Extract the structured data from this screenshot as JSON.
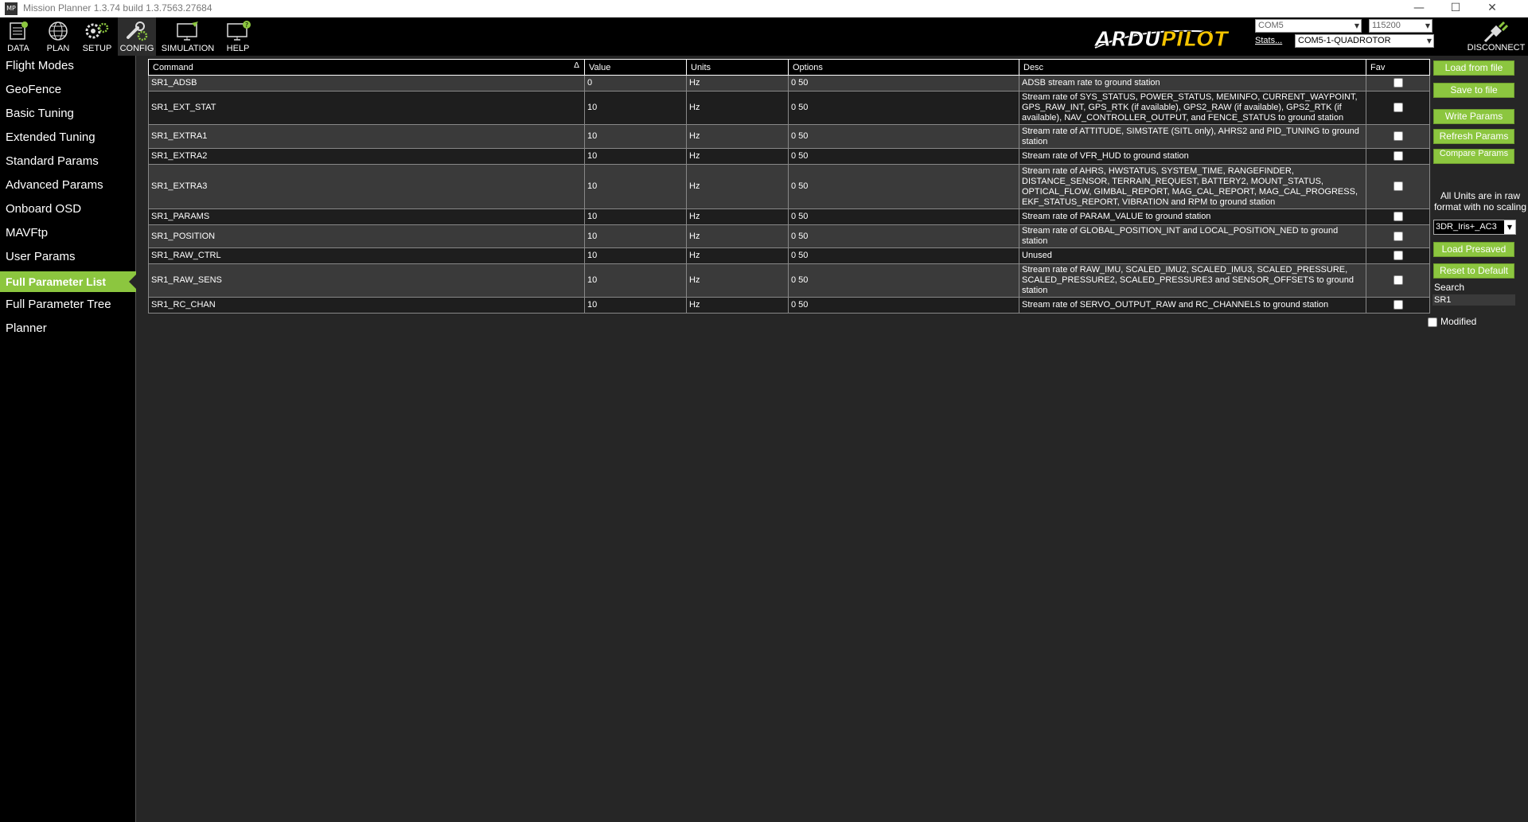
{
  "window": {
    "title": "Mission Planner 1.3.74 build 1.3.7563.27684",
    "app_icon": "MP"
  },
  "toolbar": {
    "buttons": [
      {
        "label": "DATA",
        "icon": "data-icon"
      },
      {
        "label": "PLAN",
        "icon": "globe-icon"
      },
      {
        "label": "SETUP",
        "icon": "gears-icon"
      },
      {
        "label": "CONFIG",
        "icon": "wrench-icon"
      },
      {
        "label": "SIMULATION",
        "icon": "monitor-plane-icon"
      },
      {
        "label": "HELP",
        "icon": "monitor-help-icon"
      }
    ],
    "active": "CONFIG",
    "logo": {
      "part1": "ARDU",
      "part2": "PILOT"
    },
    "port": "COM5",
    "baud": "115200",
    "stats_link": "Stats...",
    "connection": "COM5-1-QUADROTOR",
    "disconnect_label": "DISCONNECT"
  },
  "sidebar": {
    "items": [
      {
        "label": "Flight Modes"
      },
      {
        "label": "GeoFence"
      },
      {
        "label": "Basic Tuning"
      },
      {
        "label": "Extended Tuning"
      },
      {
        "label": "Standard Params"
      },
      {
        "label": "Advanced Params"
      },
      {
        "label": "Onboard OSD"
      },
      {
        "label": "MAVFtp"
      },
      {
        "label": "User Params"
      },
      {
        "label": "Full Parameter List"
      },
      {
        "label": "Full Parameter Tree"
      },
      {
        "label": "Planner"
      }
    ],
    "active": "Full Parameter List"
  },
  "table": {
    "headers": {
      "command": "Command",
      "value": "Value",
      "units": "Units",
      "options": "Options",
      "desc": "Desc",
      "fav": "Fav"
    },
    "sort_indicator": "Δ",
    "rows": [
      {
        "command": "SR1_ADSB",
        "value": "0",
        "units": "Hz",
        "options": "0 50",
        "desc": "ADSB stream rate to ground station"
      },
      {
        "command": "SR1_EXT_STAT",
        "value": "10",
        "units": "Hz",
        "options": "0 50",
        "desc": "Stream rate of SYS_STATUS, POWER_STATUS, MEMINFO, CURRENT_WAYPOINT, GPS_RAW_INT, GPS_RTK (if available), GPS2_RAW (if available), GPS2_RTK (if available), NAV_CONTROLLER_OUTPUT, and FENCE_STATUS to ground station"
      },
      {
        "command": "SR1_EXTRA1",
        "value": "10",
        "units": "Hz",
        "options": "0 50",
        "desc": "Stream rate of ATTITUDE, SIMSTATE (SITL only), AHRS2 and PID_TUNING to ground station"
      },
      {
        "command": "SR1_EXTRA2",
        "value": "10",
        "units": "Hz",
        "options": "0 50",
        "desc": "Stream rate of VFR_HUD to ground station"
      },
      {
        "command": "SR1_EXTRA3",
        "value": "10",
        "units": "Hz",
        "options": "0 50",
        "desc": "Stream rate of AHRS, HWSTATUS, SYSTEM_TIME, RANGEFINDER, DISTANCE_SENSOR, TERRAIN_REQUEST, BATTERY2, MOUNT_STATUS, OPTICAL_FLOW, GIMBAL_REPORT, MAG_CAL_REPORT, MAG_CAL_PROGRESS, EKF_STATUS_REPORT, VIBRATION and RPM to ground station"
      },
      {
        "command": "SR1_PARAMS",
        "value": "10",
        "units": "Hz",
        "options": "0 50",
        "desc": "Stream rate of PARAM_VALUE to ground station"
      },
      {
        "command": "SR1_POSITION",
        "value": "10",
        "units": "Hz",
        "options": "0 50",
        "desc": "Stream rate of GLOBAL_POSITION_INT and LOCAL_POSITION_NED to ground station"
      },
      {
        "command": "SR1_RAW_CTRL",
        "value": "10",
        "units": "Hz",
        "options": "0 50",
        "desc": "Unused"
      },
      {
        "command": "SR1_RAW_SENS",
        "value": "10",
        "units": "Hz",
        "options": "0 50",
        "desc": "Stream rate of RAW_IMU, SCALED_IMU2, SCALED_IMU3, SCALED_PRESSURE, SCALED_PRESSURE2, SCALED_PRESSURE3 and SENSOR_OFFSETS to ground station"
      },
      {
        "command": "SR1_RC_CHAN",
        "value": "10",
        "units": "Hz",
        "options": "0 50",
        "desc": "Stream rate of SERVO_OUTPUT_RAW and RC_CHANNELS to ground station"
      }
    ]
  },
  "right_panel": {
    "load_from_file": "Load from file",
    "save_to_file": "Save to file",
    "write_params": "Write Params",
    "refresh_params": "Refresh Params",
    "compare_params": "Compare Params",
    "note_line1": "All Units are in raw",
    "note_line2": "format with no scaling",
    "preset": "3DR_Iris+_AC3",
    "load_presaved": "Load Presaved",
    "reset_to_default": "Reset to Default",
    "search_label": "Search",
    "search_value": "SR1",
    "modified_label": "Modified"
  },
  "colors": {
    "accent_green": "#8cc63f",
    "background": "#262626",
    "logo_yellow": "#f5c400"
  }
}
